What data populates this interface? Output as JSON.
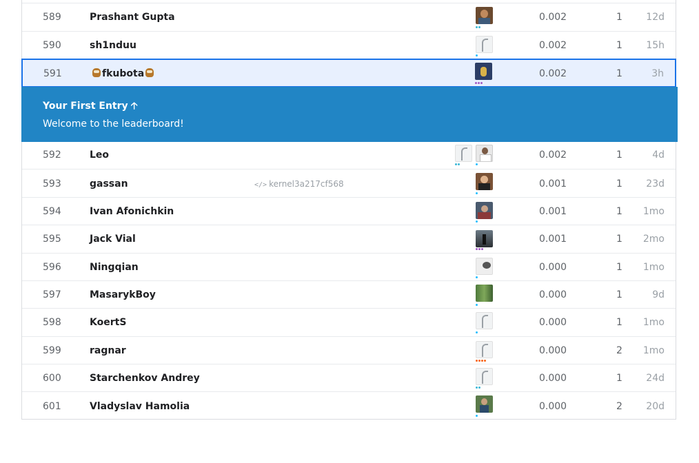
{
  "colors": {
    "accent": "#2185c5",
    "highlight_bg": "#e8f0fe",
    "tier_contributor": "#3db8d6",
    "tier_expert": "#a25bc4",
    "tier_novice": "#20beff",
    "tier_master": "#f96517"
  },
  "rows": [
    {
      "rank": "589",
      "name": "Prashant Gupta",
      "score": "0.002",
      "entries": "1",
      "last": "12d"
    },
    {
      "rank": "590",
      "name": "sh1nduu",
      "score": "0.002",
      "entries": "1",
      "last": "15h"
    },
    {
      "rank": "591",
      "name": "fkubota",
      "score": "0.002",
      "entries": "1",
      "last": "3h"
    },
    {
      "rank": "592",
      "name": "Leo",
      "score": "0.002",
      "entries": "1",
      "last": "4d"
    },
    {
      "rank": "593",
      "name": "gassan",
      "kernel": "kernel3a217cf568",
      "score": "0.001",
      "entries": "1",
      "last": "23d"
    },
    {
      "rank": "594",
      "name": "Ivan Afonichkin",
      "score": "0.001",
      "entries": "1",
      "last": "1mo"
    },
    {
      "rank": "595",
      "name": "Jack Vial",
      "score": "0.001",
      "entries": "1",
      "last": "2mo"
    },
    {
      "rank": "596",
      "name": "Ningqian",
      "score": "0.000",
      "entries": "1",
      "last": "1mo"
    },
    {
      "rank": "597",
      "name": "MasarykBoy",
      "score": "0.000",
      "entries": "1",
      "last": "9d"
    },
    {
      "rank": "598",
      "name": "KoertS",
      "score": "0.000",
      "entries": "1",
      "last": "1mo"
    },
    {
      "rank": "599",
      "name": "ragnar",
      "score": "0.000",
      "entries": "2",
      "last": "1mo"
    },
    {
      "rank": "600",
      "name": "Starchenkov Andrey",
      "score": "0.000",
      "entries": "1",
      "last": "24d"
    },
    {
      "rank": "601",
      "name": "Vladyslav Hamolia",
      "score": "0.000",
      "entries": "2",
      "last": "20d"
    }
  ],
  "banner": {
    "title": "Your First Entry",
    "arrow_icon": "arrow-up-icon",
    "message": "Welcome to the leaderboard!"
  },
  "icons": {
    "kernel": "code-icon",
    "name_decoration": "owl-icon"
  }
}
